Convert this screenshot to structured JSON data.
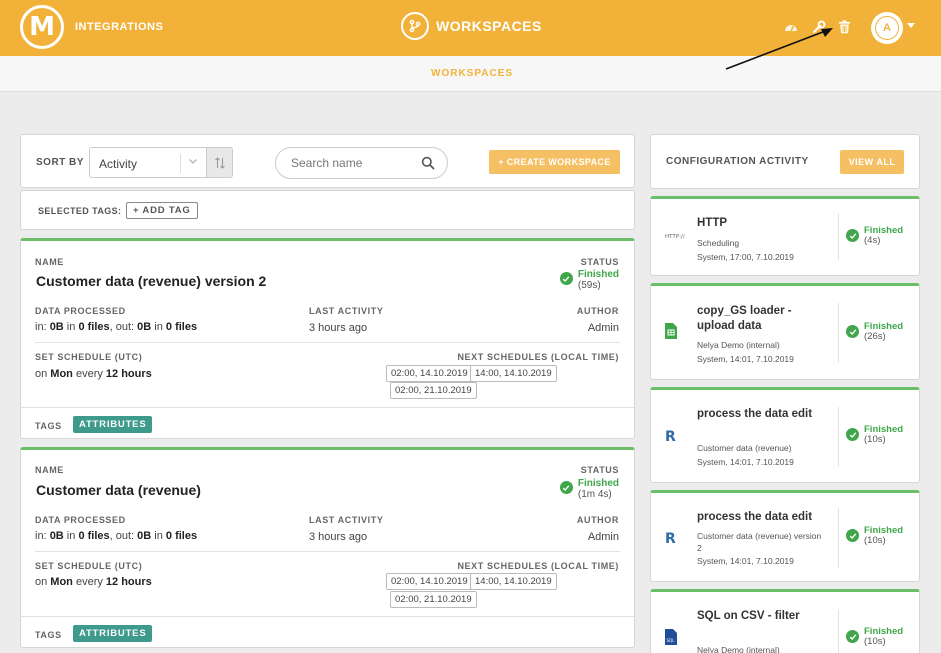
{
  "header": {
    "brand": "INTEGRATIONS",
    "center_title": "WORKSPACES",
    "avatar_letter": "A",
    "subtab": "WORKSPACES",
    "accent_color": "#f2b23a"
  },
  "toolbar": {
    "sort_by_label": "SORT BY",
    "sort_value": "Activity",
    "search_placeholder": "Search name",
    "create_label": "+ CREATE WORKSPACE"
  },
  "tags": {
    "selected_label": "SELECTED TAGS:",
    "add_tag_label": "+ ADD TAG"
  },
  "workspaces": [
    {
      "name_label": "NAME",
      "name": "Customer data (revenue) version 2",
      "status_label": "STATUS",
      "status": "Finished",
      "duration": "(59s)",
      "data_processed_label": "DATA PROCESSED",
      "data_processed": {
        "in_size": "0B",
        "in_files": "0 files",
        "out_size": "0B",
        "out_files": "0 files"
      },
      "last_activity_label": "LAST ACTIVITY",
      "last_activity": "3 hours ago",
      "author_label": "AUTHOR",
      "author": "Admin",
      "schedule_label": "SET SCHEDULE (UTC)",
      "schedule": {
        "day": "Mon",
        "time": "12 hours"
      },
      "next_label": "NEXT SCHEDULES (LOCAL TIME)",
      "next_schedules": [
        "02:00, 14.10.2019",
        "14:00, 14.10.2019",
        "02:00, 21.10.2019"
      ],
      "tags_label": "TAGS",
      "tag": "ATTRIBUTES"
    },
    {
      "name_label": "NAME",
      "name": "Customer data (revenue)",
      "status_label": "STATUS",
      "status": "Finished",
      "duration": "(1m 4s)",
      "data_processed_label": "DATA PROCESSED",
      "data_processed": {
        "in_size": "0B",
        "in_files": "0 files",
        "out_size": "0B",
        "out_files": "0 files"
      },
      "last_activity_label": "LAST ACTIVITY",
      "last_activity": "3 hours ago",
      "author_label": "AUTHOR",
      "author": "Admin",
      "schedule_label": "SET SCHEDULE (UTC)",
      "schedule": {
        "day": "Mon",
        "time": "12 hours"
      },
      "next_label": "NEXT SCHEDULES (LOCAL TIME)",
      "next_schedules": [
        "02:00, 14.10.2019",
        "14:00, 14.10.2019",
        "02:00, 21.10.2019"
      ],
      "tags_label": "TAGS",
      "tag": "ATTRIBUTES"
    }
  ],
  "config_activity": {
    "title": "CONFIGURATION ACTIVITY",
    "view_all_label": "VIEW ALL",
    "items": [
      {
        "icon": "http-icon",
        "icon_text": "HTTP://",
        "name": "HTTP",
        "desc": "Scheduling",
        "meta": "System, 17:00, 7.10.2019",
        "status": "Finished",
        "duration": "(4s)"
      },
      {
        "icon": "sheets-icon",
        "name": "copy_GS loader - upload data",
        "desc": "Nelya Demo (internal)",
        "meta": "System, 14:01, 7.10.2019",
        "status": "Finished",
        "duration": "(26s)"
      },
      {
        "icon": "r-icon",
        "icon_text": "R",
        "name": "process the data edit",
        "desc": "Customer data (revenue)",
        "meta": "System, 14:01, 7.10.2019",
        "status": "Finished",
        "duration": "(10s)"
      },
      {
        "icon": "r-icon",
        "icon_text": "R",
        "name": "process the data edit",
        "desc": "Customer data (revenue) version 2",
        "meta": "System, 14:01, 7.10.2019",
        "status": "Finished",
        "duration": "(10s)"
      },
      {
        "icon": "sql-icon",
        "icon_text": "SQL",
        "name": "SQL on CSV - filter",
        "desc": "Nelya Demo (internal)",
        "meta": "",
        "status": "Finished",
        "duration": "(10s)"
      }
    ]
  },
  "colors": {
    "finished": "#3fa74a",
    "tag": "#3e9a8c",
    "card_border": "#6bbf6b"
  }
}
